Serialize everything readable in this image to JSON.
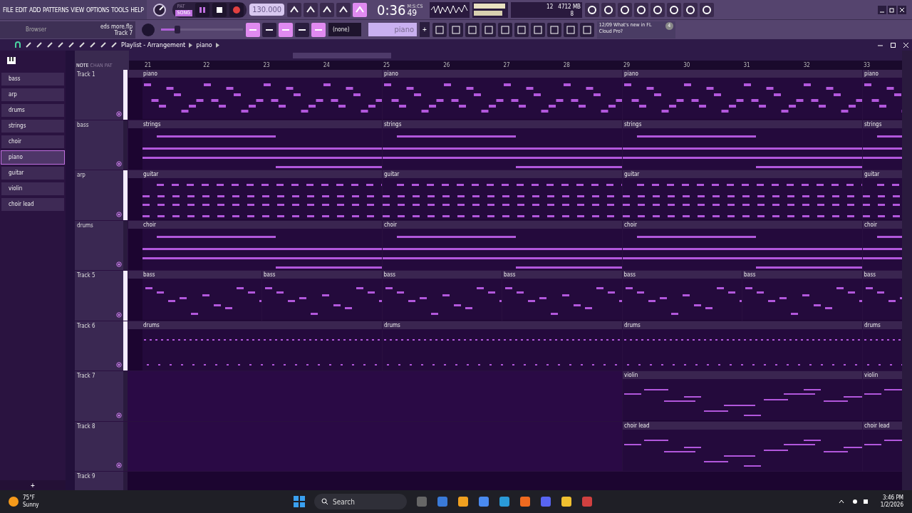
{
  "menu": [
    "FILE",
    "EDIT",
    "ADD",
    "PATTERNS",
    "VIEW",
    "OPTIONS",
    "TOOLS",
    "HELP"
  ],
  "transport": {
    "modes": [
      {
        "label": "PAT",
        "selected": false
      },
      {
        "label": "SONG",
        "selected": true
      }
    ],
    "tempo": "130.000"
  },
  "time": {
    "value": "0:36",
    "centis": "49",
    "unit": "M:S:CS"
  },
  "cpu": {
    "polyphony": "12",
    "memory": "4712 MB",
    "voices": "8"
  },
  "browser": {
    "title": "Browser",
    "project": "eds more.flp",
    "track": "Track 7"
  },
  "main_volume": {
    "level": 0.2
  },
  "pattern_selector": {
    "none": "(none)",
    "pattern": "piano",
    "add": "+"
  },
  "news": {
    "date": "12/09",
    "text": "What's new in FL Cloud Pro?",
    "badge": "4"
  },
  "playlist": {
    "breadcrumb": [
      "Playlist - Arrangement",
      "piano"
    ],
    "picker_tabs": [
      {
        "label": "NOTE",
        "selected": true
      },
      {
        "label": "CHAN",
        "selected": false
      },
      {
        "label": "PAT",
        "selected": false
      }
    ],
    "patterns": [
      {
        "name": "bass",
        "selected": false
      },
      {
        "name": "arp",
        "selected": false
      },
      {
        "name": "drums",
        "selected": false
      },
      {
        "name": "strings",
        "selected": false
      },
      {
        "name": "choir",
        "selected": false
      },
      {
        "name": "piano",
        "selected": true
      },
      {
        "name": "guitar",
        "selected": false
      },
      {
        "name": "violin",
        "selected": false
      },
      {
        "name": "choir lead",
        "selected": false
      }
    ],
    "add_pattern": "+",
    "ruler": [
      "21",
      "22",
      "23",
      "24",
      "25",
      "26",
      "27",
      "28",
      "29",
      "30",
      "31",
      "32",
      "33"
    ],
    "tracks": [
      {
        "name": "Track 1",
        "highlighted": true,
        "kind": "melody",
        "clips": [
          {
            "kind": "full",
            "label": "piano"
          },
          {
            "kind": "full",
            "label": "piano"
          },
          {
            "kind": "full",
            "label": "piano"
          },
          {
            "kind": "full",
            "label": "piano"
          }
        ]
      },
      {
        "name": "bass",
        "highlighted": false,
        "kind": "pads",
        "clips": [
          {
            "kind": "full",
            "label": "strings"
          },
          {
            "kind": "full",
            "label": "strings"
          },
          {
            "kind": "full",
            "label": "strings"
          },
          {
            "kind": "full",
            "label": "strings"
          }
        ]
      },
      {
        "name": "arp",
        "highlighted": true,
        "kind": "chords",
        "clips": [
          {
            "kind": "full",
            "label": "guitar"
          },
          {
            "kind": "full",
            "label": "guitar"
          },
          {
            "kind": "full",
            "label": "guitar"
          },
          {
            "kind": "full",
            "label": "guitar"
          }
        ]
      },
      {
        "name": "drums",
        "highlighted": false,
        "kind": "pads",
        "clips": [
          {
            "kind": "full",
            "label": "choir"
          },
          {
            "kind": "full",
            "label": "choir"
          },
          {
            "kind": "full",
            "label": "choir"
          },
          {
            "kind": "full",
            "label": "choir"
          }
        ]
      },
      {
        "name": "Track 5",
        "highlighted": true,
        "kind": "bassline",
        "clips": [
          {
            "kind": "half",
            "label": "bass"
          },
          {
            "kind": "half",
            "label": "bass"
          },
          {
            "kind": "half",
            "label": "bass"
          },
          {
            "kind": "half",
            "label": "bass"
          },
          {
            "kind": "half",
            "label": "bass"
          },
          {
            "kind": "half",
            "label": "bass"
          },
          {
            "kind": "half",
            "label": "bass"
          }
        ]
      },
      {
        "name": "Track 6",
        "highlighted": true,
        "kind": "drums",
        "clips": [
          {
            "kind": "full",
            "label": "drums"
          },
          {
            "kind": "full",
            "label": "drums"
          },
          {
            "kind": "full",
            "label": "drums"
          },
          {
            "kind": "full",
            "label": "drums"
          }
        ]
      },
      {
        "name": "Track 7",
        "highlighted": false,
        "kind": "lead",
        "clips": [
          {
            "kind": "empty"
          },
          {
            "kind": "empty"
          },
          {
            "kind": "full",
            "label": "violin"
          },
          {
            "kind": "full",
            "label": "violin"
          }
        ]
      },
      {
        "name": "Track 8",
        "highlighted": false,
        "kind": "lead",
        "clips": [
          {
            "kind": "empty"
          },
          {
            "kind": "empty"
          },
          {
            "kind": "full",
            "label": "choir lead"
          },
          {
            "kind": "full",
            "label": "choir lead"
          }
        ]
      },
      {
        "name": "Track 9",
        "highlighted": false
      }
    ]
  },
  "taskbar": {
    "temperature": "75°F",
    "weather": "Sunny",
    "search": "Search",
    "time": "3:46 PM",
    "date": "1/2/2026"
  }
}
